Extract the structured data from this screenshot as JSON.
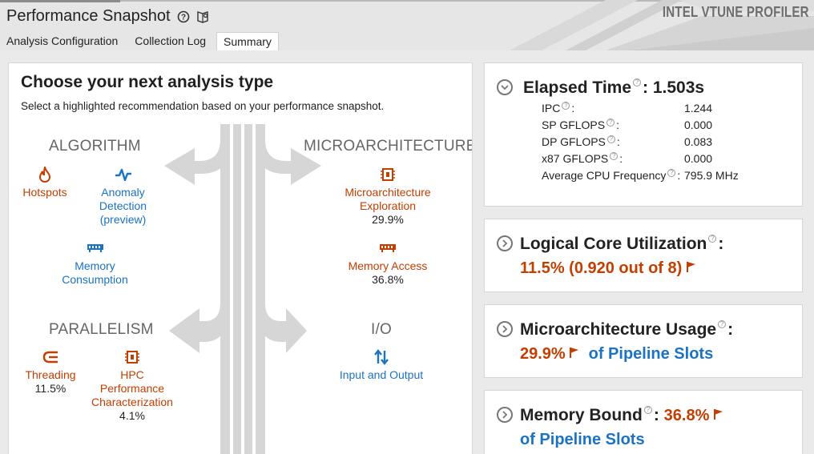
{
  "header": {
    "title": "Performance Snapshot",
    "brand": "INTEL VTUNE PROFILER",
    "tabs": [
      "Analysis Configuration",
      "Collection Log",
      "Summary"
    ],
    "active_tab": "Summary"
  },
  "left": {
    "title": "Choose your next analysis type",
    "subtitle": "Select a highlighted recommendation based on your performance snapshot.",
    "sections": {
      "algorithm": "ALGORITHM",
      "microarchitecture": "MICROARCHITECTURE",
      "parallelism": "PARALLELISM",
      "io": "I/O"
    },
    "items": {
      "hotspots": {
        "label": "Hotspots",
        "icon": "flame-icon",
        "color": "#c43e00"
      },
      "anomaly": {
        "label_lines": [
          "Anomaly",
          "Detection",
          "(preview)"
        ],
        "icon": "pulse-icon",
        "color": "#1a73c4"
      },
      "memory_consumption": {
        "label_lines": [
          "Memory",
          "Consumption"
        ],
        "icon": "ram-icon",
        "color": "#1a73c4"
      },
      "micro_exploration": {
        "label_lines": [
          "Microarchitecture",
          "Exploration"
        ],
        "value": "29.9%",
        "icon": "chip-icon",
        "color": "#c43e00"
      },
      "memory_access": {
        "label": "Memory Access",
        "value": "36.8%",
        "icon": "ram-icon",
        "color": "#c43e00"
      },
      "threading": {
        "label": "Threading",
        "value": "11.5%",
        "icon": "threads-icon",
        "color": "#c43e00"
      },
      "hpc": {
        "label_lines": [
          "HPC",
          "Performance",
          "Characterization"
        ],
        "value": "4.1%",
        "icon": "chip-icon",
        "color": "#c43e00"
      },
      "io": {
        "label": "Input and Output",
        "icon": "up-down-arrows-icon",
        "color": "#1a73c4"
      }
    }
  },
  "cards": {
    "elapsed": {
      "title": "Elapsed Time",
      "value": ": 1.503s",
      "metrics": [
        {
          "name": "IPC",
          "value": "1.244"
        },
        {
          "name": "SP GFLOPS",
          "value": "0.000"
        },
        {
          "name": "DP GFLOPS",
          "value": "0.083"
        },
        {
          "name": "x87 GFLOPS",
          "value": "0.000"
        },
        {
          "name": "Average CPU Frequency",
          "value": "795.9 MHz"
        }
      ]
    },
    "logical_core": {
      "title": "Logical Core Utilization",
      "value": "11.5% (0.920 out of 8)"
    },
    "micro_usage": {
      "title": "Microarchitecture Usage",
      "value": "29.9%",
      "suffix": "of Pipeline Slots"
    },
    "memory_bound": {
      "title": "Memory Bound",
      "value": "36.8%",
      "suffix": "of Pipeline Slots"
    }
  },
  "colors": {
    "accent_orange": "#c43e00",
    "accent_blue": "#1a73c4"
  }
}
